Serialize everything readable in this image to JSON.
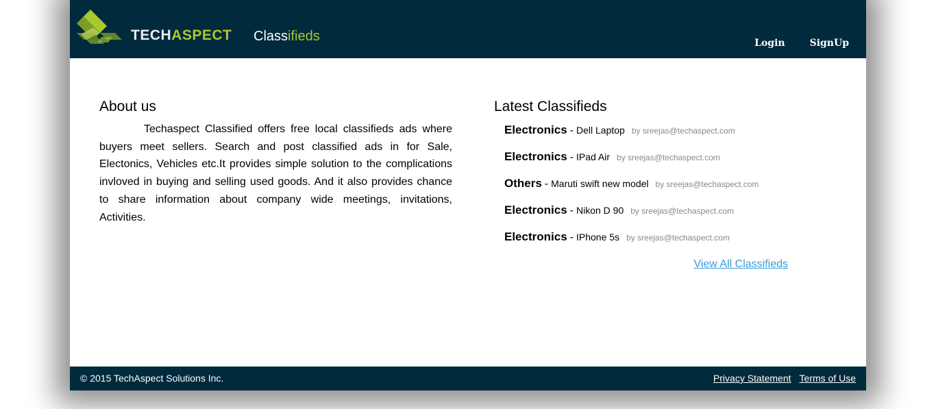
{
  "brand": {
    "tech": "TECH",
    "aspect": "ASPECT",
    "product_part1": "Class",
    "product_part2": "ifieds",
    "accent_color": "#a9c82e",
    "header_color": "#022a3d"
  },
  "nav": {
    "login": "Login",
    "signup": "SignUp"
  },
  "about": {
    "title": "About us",
    "text": "Techaspect Classified offers free local classifieds ads where buyers meet sellers. Search and post classified ads in for Sale, Electonics, Vehicles etc.It provides simple solution to the complications invloved in buying and selling used goods. And it also provides chance to share information about company wide meetings, invitations, Activities."
  },
  "latest": {
    "title": "Latest Classifieds",
    "items": [
      {
        "category": "Electronics",
        "dash": "-",
        "title": "Dell Laptop",
        "by": "by sreejas@techaspect.com"
      },
      {
        "category": "Electronics",
        "dash": "-",
        "title": "IPad Air",
        "by": "by sreejas@techaspect.com"
      },
      {
        "category": "Others",
        "dash": "-",
        "title": "Maruti swift new model",
        "by": "by sreejas@techaspect.com"
      },
      {
        "category": "Electronics",
        "dash": "-",
        "title": "Nikon D 90",
        "by": "by sreejas@techaspect.com"
      },
      {
        "category": "Electronics",
        "dash": "-",
        "title": "IPhone 5s",
        "by": "by sreejas@techaspect.com"
      }
    ],
    "view_all": "View All Classifieds"
  },
  "footer": {
    "copyright": "© 2015 TechAspect Solutions Inc.",
    "privacy": "Privacy Statement",
    "terms": "Terms of Use"
  },
  "icons": {
    "logo": "techaspect-logo-icon"
  }
}
